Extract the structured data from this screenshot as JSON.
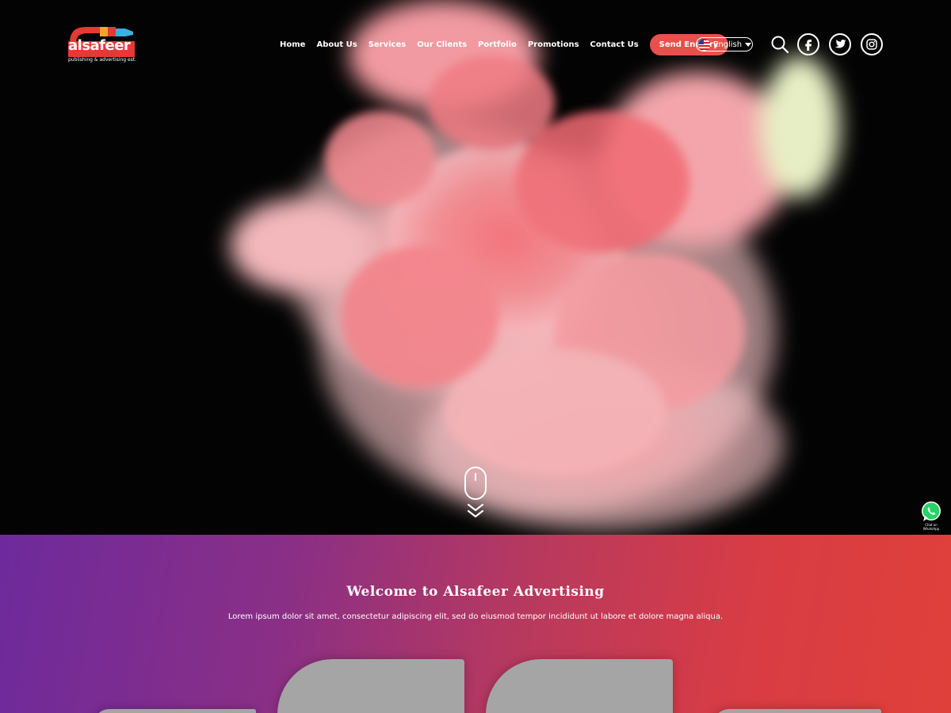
{
  "brand": {
    "name": "alsafeer",
    "tagline": "publishing & advertising est."
  },
  "nav": {
    "items": [
      "Home",
      "About Us",
      "Services",
      "Our Clients",
      "Portfolio",
      "Promotions",
      "Contact Us"
    ],
    "cta": "Send Enquiry"
  },
  "language": {
    "selected": "English",
    "flag": "us-flag-icon"
  },
  "icons": [
    "search-icon",
    "facebook-icon",
    "twitter-icon",
    "instagram-icon",
    "mouse-scroll-icon",
    "whatsapp-icon"
  ],
  "whatsapp": {
    "label": "Chat on WhatsApp"
  },
  "welcome": {
    "title": "Welcome to Alsafeer Advertising",
    "body": "Lorem ipsum dolor sit amet, consectetur adipiscing elit, sed do eiusmod tempor incididunt ut labore et dolore magna aliqua."
  },
  "colors": {
    "accent": "#e8504c",
    "gradient_start": "#6d2a9c",
    "gradient_end": "#e0403a",
    "smoke": "#f07a80",
    "card": "#a5a5a5"
  }
}
